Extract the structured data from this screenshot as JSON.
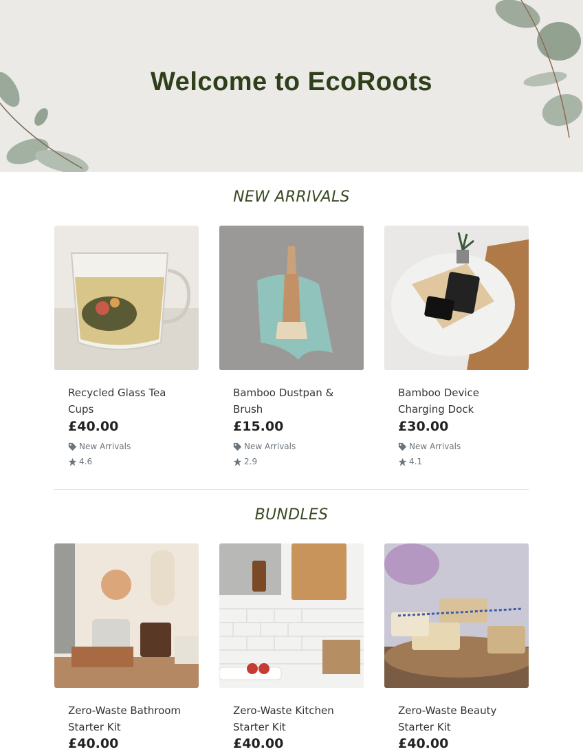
{
  "hero": {
    "title_prefix": "Welcome to ",
    "brand_bold": "Eco",
    "brand_rest": "Roots"
  },
  "sections": {
    "new_arrivals": {
      "title": "NEW ARRIVALS",
      "products": [
        {
          "name": "Recycled Glass Tea Cups",
          "price": "£40.00",
          "category": "New Arrivals",
          "rating": "4.6",
          "image": "tea-cup-image"
        },
        {
          "name": "Bamboo Dustpan & Brush",
          "price": "£15.00",
          "category": "New Arrivals",
          "rating": "2.9",
          "image": "dustpan-image"
        },
        {
          "name": "Bamboo Device Charging Dock",
          "price": "£30.00",
          "category": "New Arrivals",
          "rating": "4.1",
          "image": "charging-dock-image"
        }
      ]
    },
    "bundles": {
      "title": "BUNDLES",
      "products": [
        {
          "name": "Zero-Waste Bathroom Starter Kit",
          "price": "£40.00",
          "image": "bathroom-kit-image"
        },
        {
          "name": "Zero-Waste Kitchen Starter Kit",
          "price": "£40.00",
          "image": "kitchen-kit-image"
        },
        {
          "name": "Zero-Waste Beauty Starter Kit",
          "price": "£40.00",
          "image": "beauty-kit-image"
        }
      ]
    }
  },
  "icons": {
    "tag": "tag-icon",
    "rating": "star-icon"
  },
  "colors": {
    "hero_bg": "#ebeae7",
    "title_green": "#2f3f1a",
    "muted": "#6c757d"
  }
}
